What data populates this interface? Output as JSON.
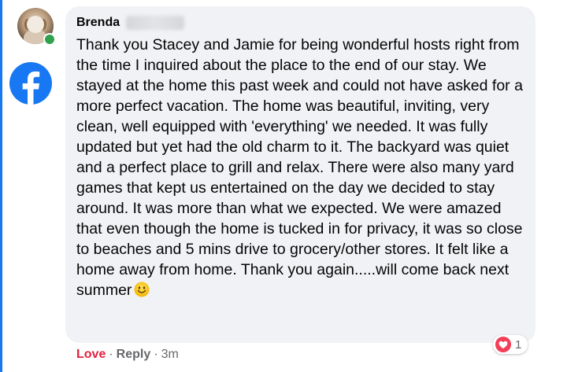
{
  "comment": {
    "author_first_name": "Brenda",
    "text": "Thank you Stacey and Jamie for being wonderful hosts right from the time I inquired about the place to the end of our stay. We stayed at the home this past week and could not have asked for a more perfect vacation. The home was beautiful, inviting, very clean, well equipped with 'everything' we needed. It was fully updated but yet had the old charm to it. The backyard was quiet and a perfect place to grill and relax. There were also many yard games that kept us entertained on the day we decided to stay around. It was more than what we expected. We were amazed that even though the home is tucked in for privacy, it was so close to beaches and 5 mins drive to grocery/other stores. It felt like a home away from home. Thank you again.....will come back next summer",
    "emoji_icon": "smiling-face-icon",
    "reactions": {
      "icon": "heart-icon",
      "count": "1"
    }
  },
  "actions": {
    "love_label": "Love",
    "separator": "·",
    "reply_label": "Reply",
    "timestamp": "3m"
  },
  "colors": {
    "brand": "#1877f2",
    "love": "#e41e3f",
    "bubble": "#f0f2f5",
    "online": "#31a24c",
    "muted": "#65676b"
  },
  "icons": {
    "brand_badge": "facebook-logo-icon",
    "presence": "online-status-dot"
  }
}
